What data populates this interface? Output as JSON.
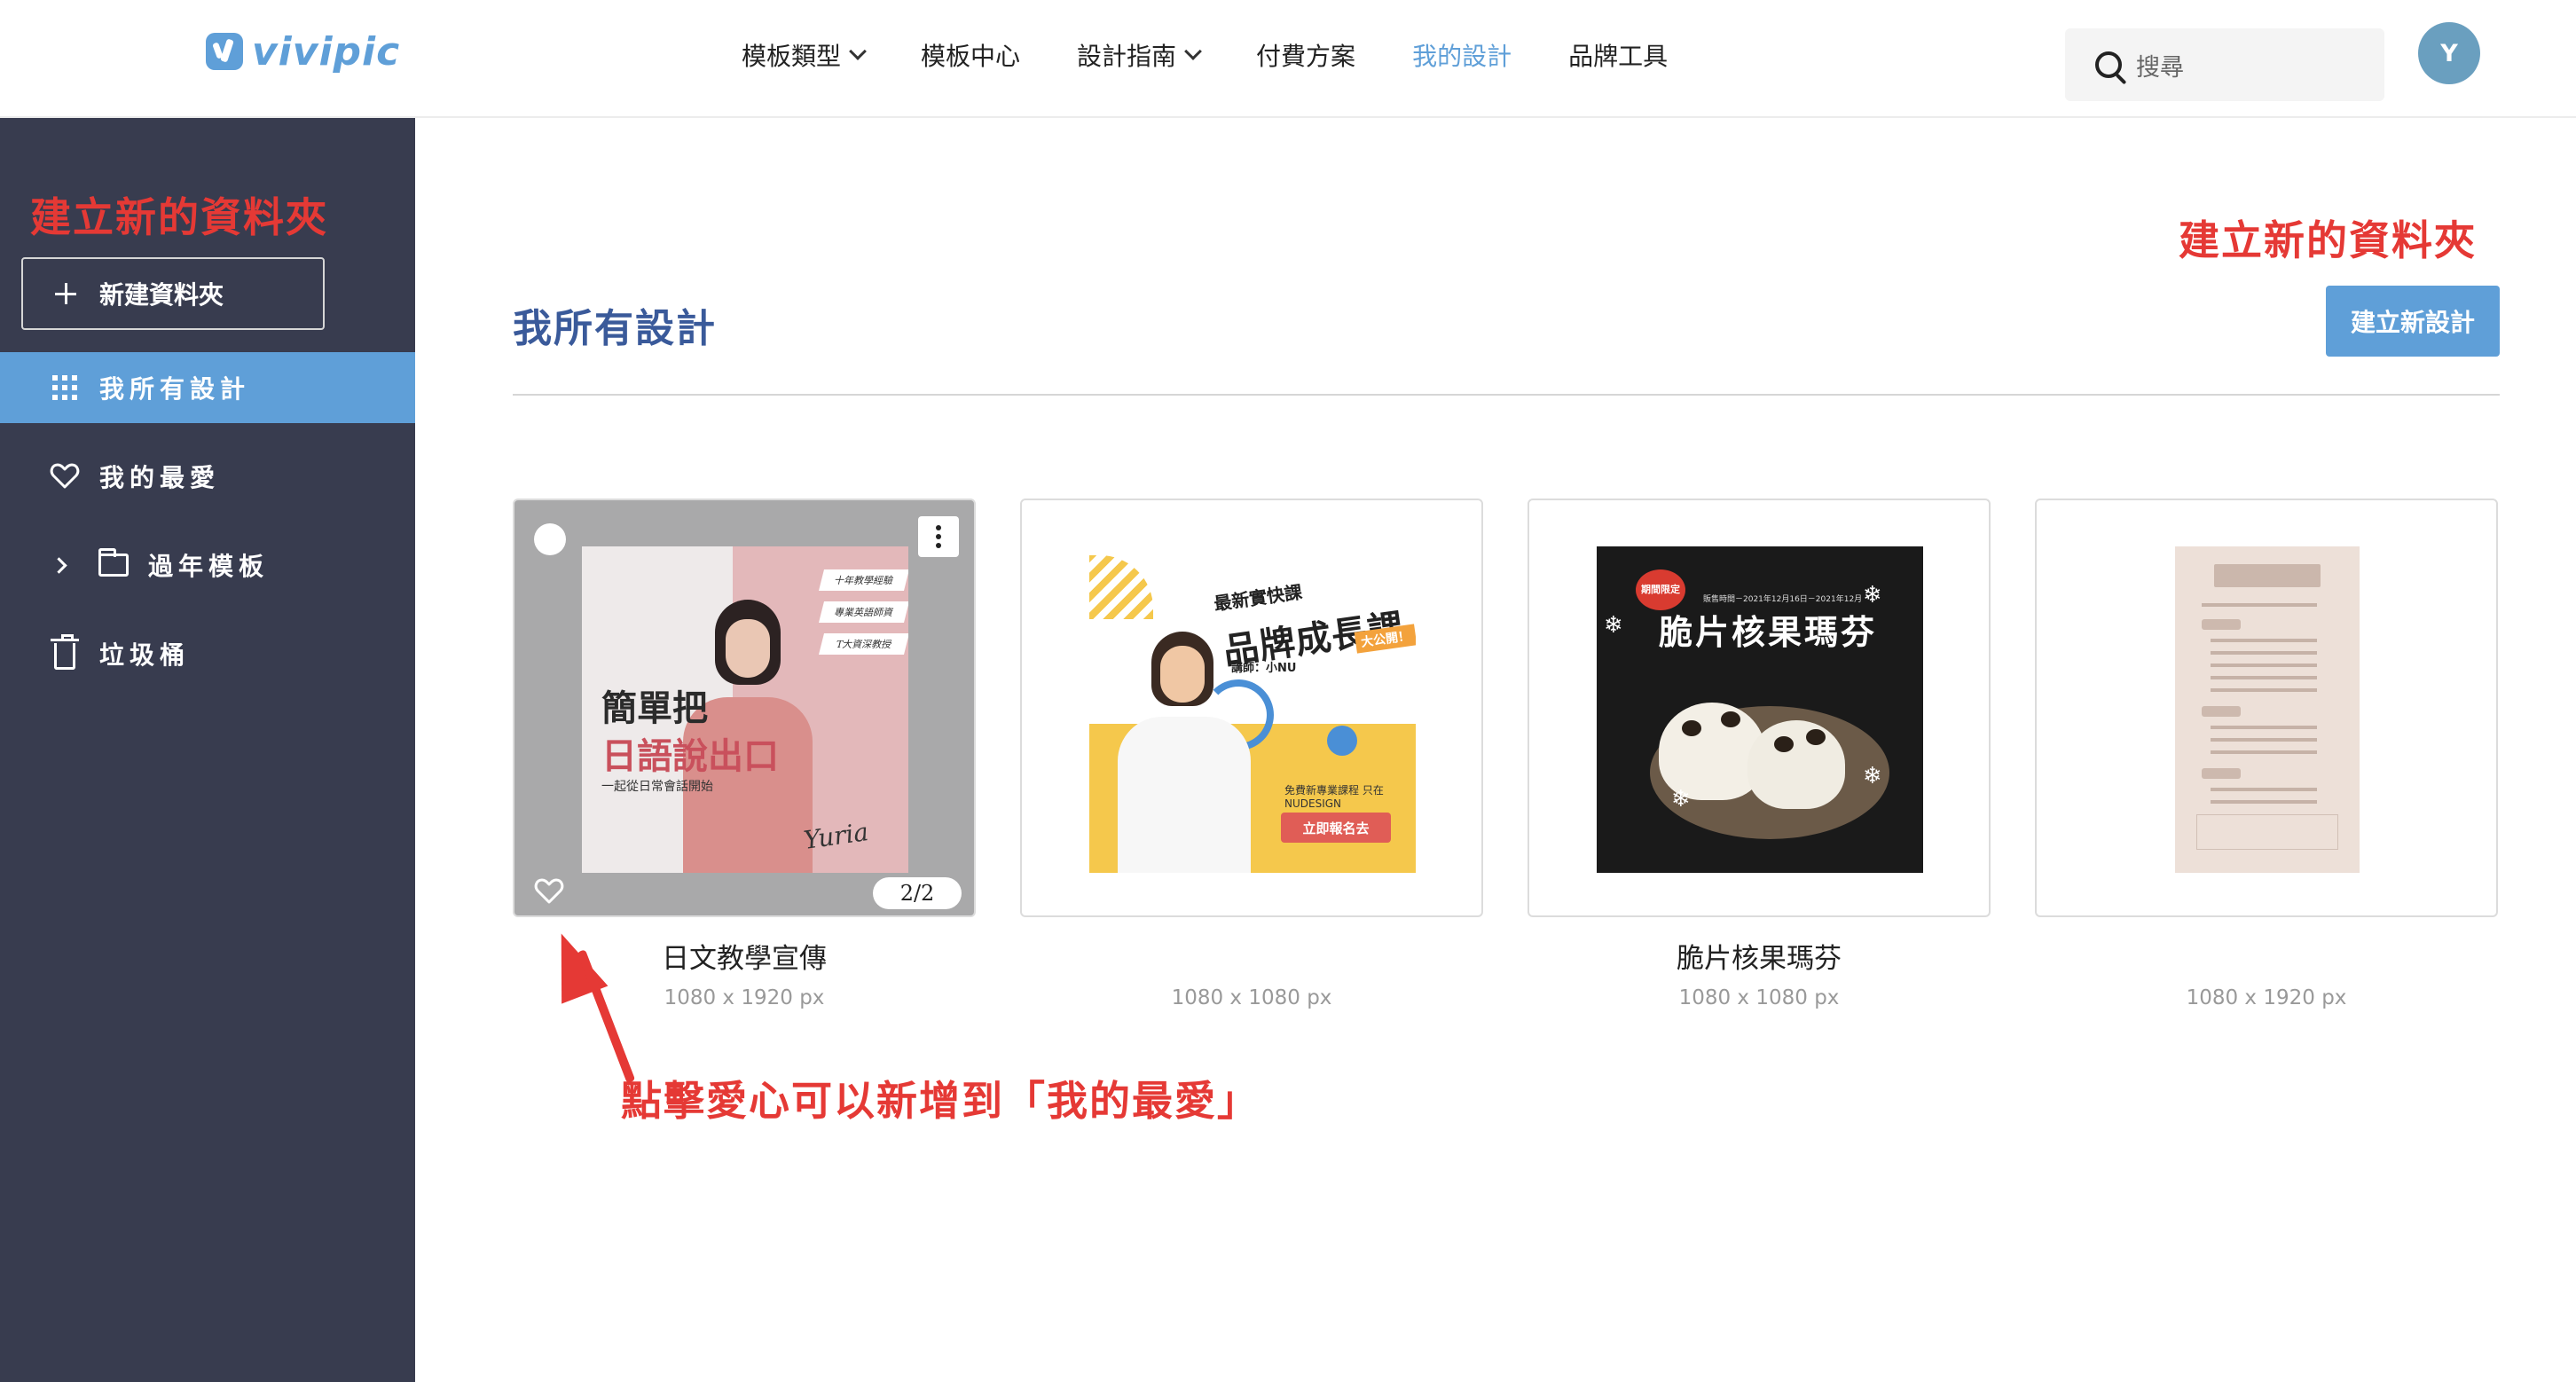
{
  "brand": {
    "name": "vivipic"
  },
  "nav": [
    {
      "label": "模板類型",
      "dropdown": true,
      "active": false
    },
    {
      "label": "模板中心",
      "dropdown": false,
      "active": false
    },
    {
      "label": "設計指南",
      "dropdown": true,
      "active": false
    },
    {
      "label": "付費方案",
      "dropdown": false,
      "active": false
    },
    {
      "label": "我的設計",
      "dropdown": false,
      "active": true
    },
    {
      "label": "品牌工具",
      "dropdown": false,
      "active": false
    }
  ],
  "search": {
    "placeholder": "搜尋",
    "icon": "search-icon"
  },
  "user": {
    "initial": "Y",
    "color": "#6a9fbf"
  },
  "sidebar": {
    "new_folder_label": "新建資料夾",
    "items": [
      {
        "label": "我所有設計",
        "icon": "grid-icon",
        "active": true
      },
      {
        "label": "我的最愛",
        "icon": "heart-icon",
        "active": false
      },
      {
        "label": "過年模板",
        "icon": "folder-icon",
        "active": false
      },
      {
        "label": "垃圾桶",
        "icon": "trash-icon",
        "active": false
      }
    ]
  },
  "main": {
    "title": "我所有設計",
    "create_button": "建立新設計",
    "designs": [
      {
        "name": "日文教學宣傳",
        "size": "1080 x 1920 px",
        "page_badge": "2/2",
        "thumb_text": {
          "title1": "簡單把",
          "title2": "日語說出口",
          "subtitle": "一起從日常會話開始",
          "tags": [
            "十年教學經驗",
            "專業英語師資",
            "T大資深教授"
          ],
          "signature": "Yuria"
        }
      },
      {
        "name": "",
        "size": "1080 x 1080 px",
        "thumb_text": {
          "eyebrow": "最新實快課",
          "title": "品牌成長課",
          "badge": "大公開！",
          "speaker": "講師：小NU",
          "note": "免費新專業課程 只在NUDESIGN",
          "cta": "立即報名去"
        }
      },
      {
        "name": "脆片核果瑪芬",
        "size": "1080 x 1080 px",
        "thumb_text": {
          "badge": "期間限定",
          "date": "販售時間－2021年12月16日－2021年12月",
          "title": "脆片核果瑪芬"
        }
      },
      {
        "name": "",
        "size": "1080 x 1920 px"
      }
    ]
  },
  "annotations": {
    "sidebar_note": "建立新的資料夾",
    "header_note": "建立新的資料夾",
    "heart_note": "點擊愛心可以新增到「我的最愛」"
  },
  "colors": {
    "accent": "#5f9fd8",
    "sidebar_bg": "#383c4f",
    "annotation": "#e53935",
    "title": "#3a5a9a"
  }
}
